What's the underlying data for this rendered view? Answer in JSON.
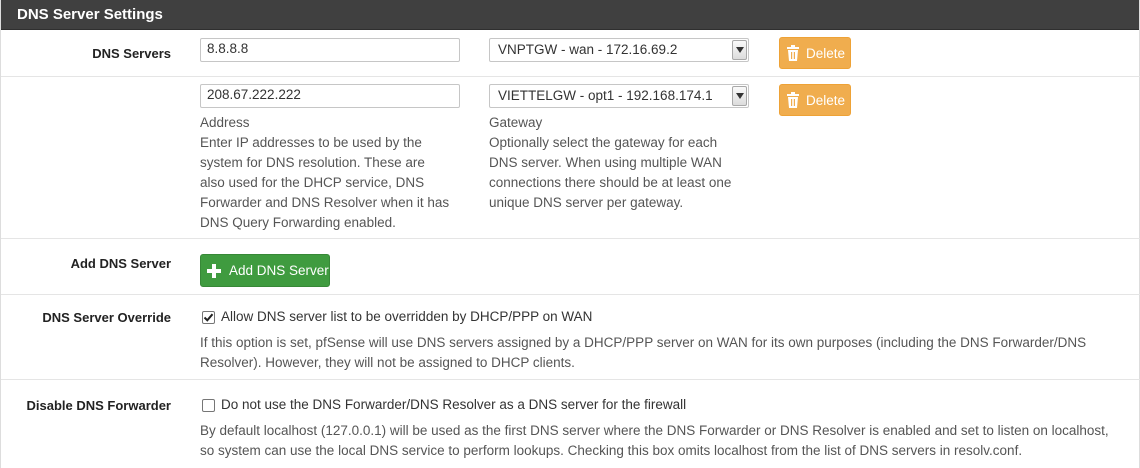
{
  "panel": {
    "title": "DNS Server Settings"
  },
  "dns_servers": {
    "label": "DNS Servers",
    "entries": [
      {
        "address": "8.8.8.8",
        "gateway": "VNPTGW - wan - 172.16.69.2",
        "delete_label": "Delete"
      },
      {
        "address": "208.67.222.222",
        "gateway": "VIETTELGW - opt1 - 192.168.174.1",
        "delete_label": "Delete"
      }
    ],
    "address_help": {
      "head": "Address",
      "lines": [
        "Enter IP addresses to be used by the",
        "system for DNS resolution. These are",
        "also used for the DHCP service, DNS",
        "Forwarder and DNS Resolver when it has",
        "DNS Query Forwarding enabled."
      ]
    },
    "gateway_help": {
      "head": "Gateway",
      "lines": [
        "Optionally select the gateway for each",
        "DNS server. When using multiple WAN",
        "connections there should be at least one",
        "unique DNS server per gateway."
      ]
    }
  },
  "add_dns": {
    "label": "Add DNS Server",
    "button_label": "Add DNS Server"
  },
  "override": {
    "label": "DNS Server Override",
    "checked": true,
    "checkbox_label": "Allow DNS server list to be overridden by DHCP/PPP on WAN",
    "help_lines": [
      "If this option is set, pfSense will use DNS servers assigned by a DHCP/PPP server on WAN for its own purposes (including the DNS Forwarder/DNS",
      "Resolver). However, they will not be assigned to DHCP clients."
    ]
  },
  "disable_forwarder": {
    "label": "Disable DNS Forwarder",
    "checked": false,
    "checkbox_label": "Do not use the DNS Forwarder/DNS Resolver as a DNS server for the firewall",
    "help_lines": [
      "By default localhost (127.0.0.1) will be used as the first DNS server where the DNS Forwarder or DNS Resolver is enabled and set to listen on localhost,",
      "so system can use the local DNS service to perform lookups. Checking this box omits localhost from the list of DNS servers in resolv.conf."
    ]
  },
  "colors": {
    "header_bg": "#404040",
    "delete_btn": "#f0ad4e",
    "add_btn": "#3f9b3f"
  }
}
